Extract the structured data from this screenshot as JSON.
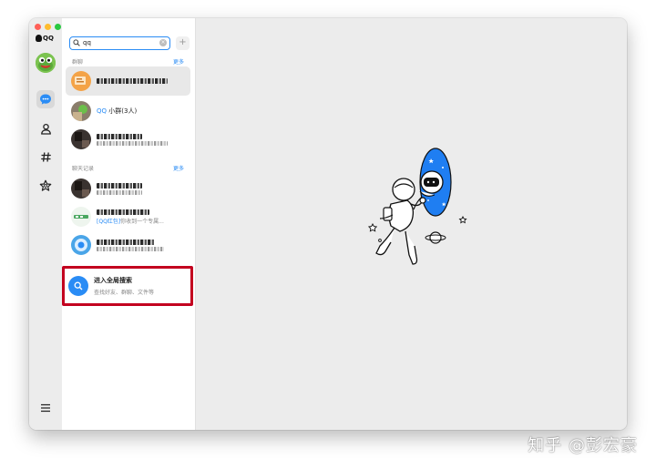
{
  "app": {
    "name": "QQ",
    "search_query": "qq"
  },
  "sections": {
    "groups": {
      "title": "群聊",
      "more": "更多"
    },
    "history": {
      "title": "聊天记录",
      "more": "更多"
    }
  },
  "groups": [
    {
      "name_prefix": "QQ",
      "name_rest": " 小群",
      "count": "(3人)"
    }
  ],
  "history": [
    {
      "sub_hl": "[QQ红包]",
      "sub_rest": "你收到一个专属..."
    }
  ],
  "global_search": {
    "title": "进入全局搜索",
    "subtitle": "查找好友、群聊、文件等"
  },
  "watermark": "知乎 @彭宏豪",
  "colors": {
    "accent": "#2a8cf5",
    "highlight_box": "#c3001f"
  },
  "icons": [
    "qq-penguin-icon",
    "chat-bubble-icon",
    "contacts-icon",
    "hashtag-icon",
    "star-icon",
    "menu-icon",
    "search-icon",
    "clear-icon",
    "plus-icon"
  ]
}
